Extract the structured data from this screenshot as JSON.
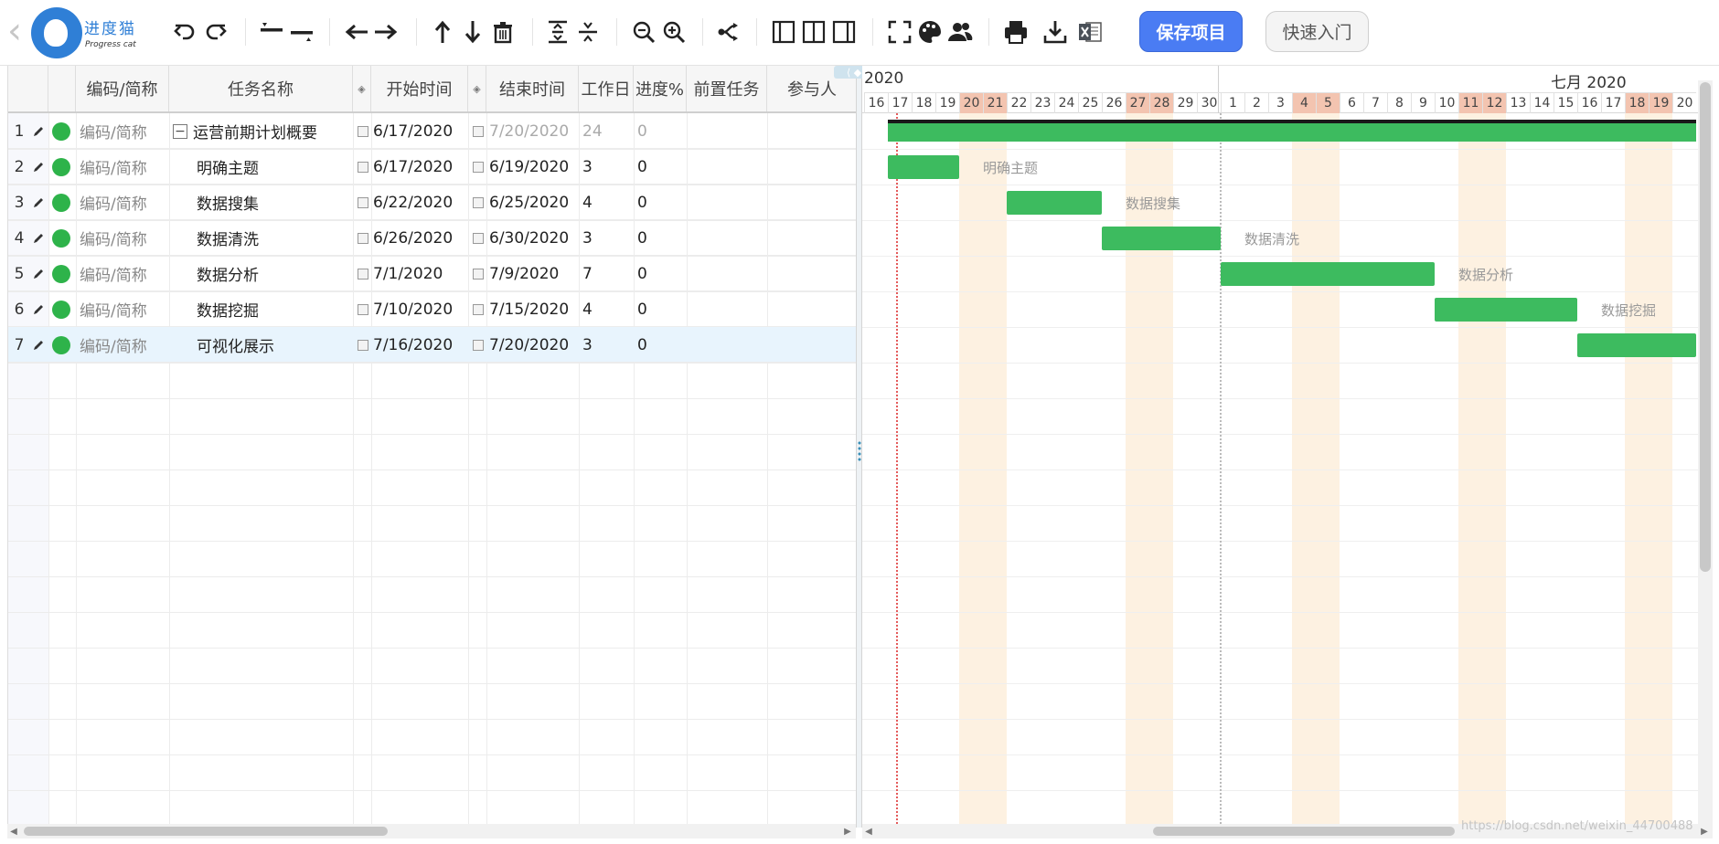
{
  "app": {
    "logo_text": "进度猫",
    "logo_subtitle": "Progress cat"
  },
  "toolbar": {
    "icons": [
      "back-icon",
      "undo-icon",
      "redo-icon",
      "indent-icon",
      "outdent-icon",
      "move-left-icon",
      "move-right-icon",
      "move-up-icon",
      "move-down-icon",
      "delete-icon",
      "expand-rows-icon",
      "collapse-rows-icon",
      "zoom-out-icon",
      "zoom-in-icon",
      "link-icon",
      "layout-grid-icon",
      "layout-split-icon",
      "layout-chart-icon",
      "fullscreen-icon",
      "palette-icon",
      "users-icon",
      "print-icon",
      "download-icon",
      "excel-icon"
    ],
    "save_label": "保存项目",
    "quick_start_label": "快速入门"
  },
  "grid": {
    "columns": {
      "code": "编码/简称",
      "name": "任务名称",
      "start": "开始时间",
      "end": "结束时间",
      "days": "工作日",
      "progress": "进度%",
      "predecessor": "前置任务",
      "participants": "参与人"
    },
    "rows": [
      {
        "num": "1",
        "code": "编码/简称",
        "name": "运营前期计划概要",
        "start": "6/17/2020",
        "end": "7/20/2020",
        "days": "24",
        "progress": "0",
        "summary": true
      },
      {
        "num": "2",
        "code": "编码/简称",
        "name": "明确主题",
        "start": "6/17/2020",
        "end": "6/19/2020",
        "days": "3",
        "progress": "0"
      },
      {
        "num": "3",
        "code": "编码/简称",
        "name": "数据搜集",
        "start": "6/22/2020",
        "end": "6/25/2020",
        "days": "4",
        "progress": "0"
      },
      {
        "num": "4",
        "code": "编码/简称",
        "name": "数据清洗",
        "start": "6/26/2020",
        "end": "6/30/2020",
        "days": "3",
        "progress": "0"
      },
      {
        "num": "5",
        "code": "编码/简称",
        "name": "数据分析",
        "start": "7/1/2020",
        "end": "7/9/2020",
        "days": "7",
        "progress": "0"
      },
      {
        "num": "6",
        "code": "编码/简称",
        "name": "数据挖掘",
        "start": "7/10/2020",
        "end": "7/15/2020",
        "days": "4",
        "progress": "0"
      },
      {
        "num": "7",
        "code": "编码/简称",
        "name": "可视化展示",
        "start": "7/16/2020",
        "end": "7/20/2020",
        "days": "3",
        "progress": "0",
        "selected": true
      }
    ]
  },
  "gantt": {
    "month_june": "2020",
    "month_july": "七月 2020",
    "days": [
      "16",
      "17",
      "18",
      "19",
      "20",
      "21",
      "22",
      "23",
      "24",
      "25",
      "26",
      "27",
      "28",
      "29",
      "30",
      "1",
      "2",
      "3",
      "4",
      "5",
      "6",
      "7",
      "8",
      "9",
      "10",
      "11",
      "12",
      "13",
      "14",
      "15",
      "16",
      "17",
      "18",
      "19",
      "20"
    ],
    "weekend_days_index": [
      4,
      5,
      11,
      12,
      18,
      19,
      25,
      26,
      32,
      33
    ],
    "bars": [
      {
        "task": "运营前期计划概要",
        "start": "6/17/2020",
        "end": "7/20/2020",
        "label": "",
        "summary": true
      },
      {
        "task": "明确主题",
        "start": "6/17/2020",
        "end": "6/19/2020",
        "label": "明确主题"
      },
      {
        "task": "数据搜集",
        "start": "6/22/2020",
        "end": "6/25/2020",
        "label": "数据搜集"
      },
      {
        "task": "数据清洗",
        "start": "6/26/2020",
        "end": "6/30/2020",
        "label": "数据清洗"
      },
      {
        "task": "数据分析",
        "start": "7/1/2020",
        "end": "7/9/2020",
        "label": "数据分析"
      },
      {
        "task": "数据挖掘",
        "start": "7/10/2020",
        "end": "7/15/2020",
        "label": "数据挖掘"
      },
      {
        "task": "可视化展示",
        "start": "7/16/2020",
        "end": "7/20/2020",
        "label": ""
      }
    ],
    "bar_color": "#3dbb5f",
    "weekend_color": "#f3c4b0"
  },
  "watermark": "https://blog.csdn.net/weixin_44700488"
}
